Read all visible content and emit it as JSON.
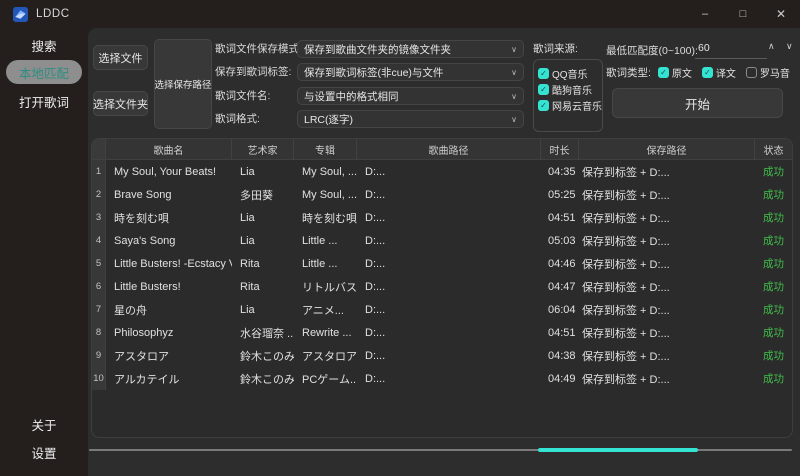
{
  "window": {
    "title": "LDDC",
    "controls": {
      "minimize": "–",
      "maximize": "□",
      "close": "✕"
    }
  },
  "sidebar": {
    "items": [
      {
        "label": "搜索"
      },
      {
        "label": "本地匹配",
        "active": true
      },
      {
        "label": "打开歌词"
      }
    ],
    "bottom_items": [
      {
        "label": "关于"
      },
      {
        "label": "设置"
      }
    ]
  },
  "controls": {
    "select_file": "选择文件",
    "select_folder": "选择文件夹",
    "select_save_path": "选择保存路径",
    "fields": [
      {
        "label": "歌词文件保存模式:",
        "value": "保存到歌曲文件夹的镜像文件夹"
      },
      {
        "label": "保存到歌词标签:",
        "value": "保存到歌词标签(非cue)与文件"
      },
      {
        "label": "歌词文件名:",
        "value": "与设置中的格式相同"
      },
      {
        "label": "歌词格式:",
        "value": "LRC(逐字)"
      }
    ],
    "source": {
      "label": "歌词来源:",
      "options": [
        {
          "label": "QQ音乐",
          "checked": true
        },
        {
          "label": "酷狗音乐",
          "checked": true
        },
        {
          "label": "网易云音乐",
          "checked": true
        }
      ]
    },
    "min_match": {
      "label": "最低匹配度(0~100):",
      "value": "60"
    },
    "lyric_type": {
      "label": "歌词类型:",
      "options": [
        {
          "label": "原文",
          "checked": true
        },
        {
          "label": "译文",
          "checked": true
        },
        {
          "label": "罗马音",
          "checked": false
        }
      ]
    },
    "start_button": "开始"
  },
  "table": {
    "headers": [
      "歌曲名",
      "艺术家",
      "专辑",
      "歌曲路径",
      "时长",
      "保存路径",
      "状态"
    ],
    "rows": [
      {
        "index": "1",
        "song": "My Soul, Your Beats!",
        "artist": "Lia",
        "album": "My Soul, ...",
        "path": "D:...",
        "duration": "04:35",
        "save_path": "保存到标签 + D:...",
        "status": "成功"
      },
      {
        "index": "2",
        "song": "Brave Song",
        "artist": "多田葵",
        "album": "My Soul, ...",
        "path": "D:...",
        "duration": "05:25",
        "save_path": "保存到标签 + D:...",
        "status": "成功"
      },
      {
        "index": "3",
        "song": "時を刻む唄",
        "artist": "Lia",
        "album": "時を刻む唄 ...",
        "path": "D:...",
        "duration": "04:51",
        "save_path": "保存到标签 + D:...",
        "status": "成功"
      },
      {
        "index": "4",
        "song": "Saya's Song",
        "artist": "Lia",
        "album": "Little ...",
        "path": "D:...",
        "duration": "05:03",
        "save_path": "保存到标签 + D:...",
        "status": "成功"
      },
      {
        "index": "5",
        "song": "Little Busters! -Ecstacy Ver.-",
        "artist": "Rita",
        "album": "Little ...",
        "path": "D:...",
        "duration": "04:46",
        "save_path": "保存到标签 + D:...",
        "status": "成功"
      },
      {
        "index": "6",
        "song": "Little Busters!",
        "artist": "Rita",
        "album": "リトルバス...",
        "path": "D:...",
        "duration": "04:47",
        "save_path": "保存到标签 + D:...",
        "status": "成功"
      },
      {
        "index": "7",
        "song": "星の舟",
        "artist": "Lia",
        "album": "アニメ...",
        "path": "D:...",
        "duration": "06:04",
        "save_path": "保存到标签 + D:...",
        "status": "成功"
      },
      {
        "index": "8",
        "song": "Philosophyz",
        "artist": "水谷瑠奈 ...",
        "album": "Rewrite ...",
        "path": "D:...",
        "duration": "04:51",
        "save_path": "保存到标签 + D:...",
        "status": "成功"
      },
      {
        "index": "9",
        "song": "アスタロア",
        "artist": "鈴木このみ",
        "album": "アスタロア/...",
        "path": "D:...",
        "duration": "04:38",
        "save_path": "保存到标签 + D:...",
        "status": "成功"
      },
      {
        "index": "10",
        "song": "アルカテイル",
        "artist": "鈴木このみ",
        "album": "PCゲーム...",
        "path": "D:...",
        "duration": "04:49",
        "save_path": "保存到标签 + D:...",
        "status": "成功"
      }
    ]
  },
  "icons": {
    "chevron_down": "∨",
    "spin_up": "∧",
    "spin_down": "∨",
    "check": "✓"
  },
  "colors": {
    "accent": "#35e3d2",
    "success": "#41bd4b",
    "selected_pill": "#8e8e8e"
  }
}
